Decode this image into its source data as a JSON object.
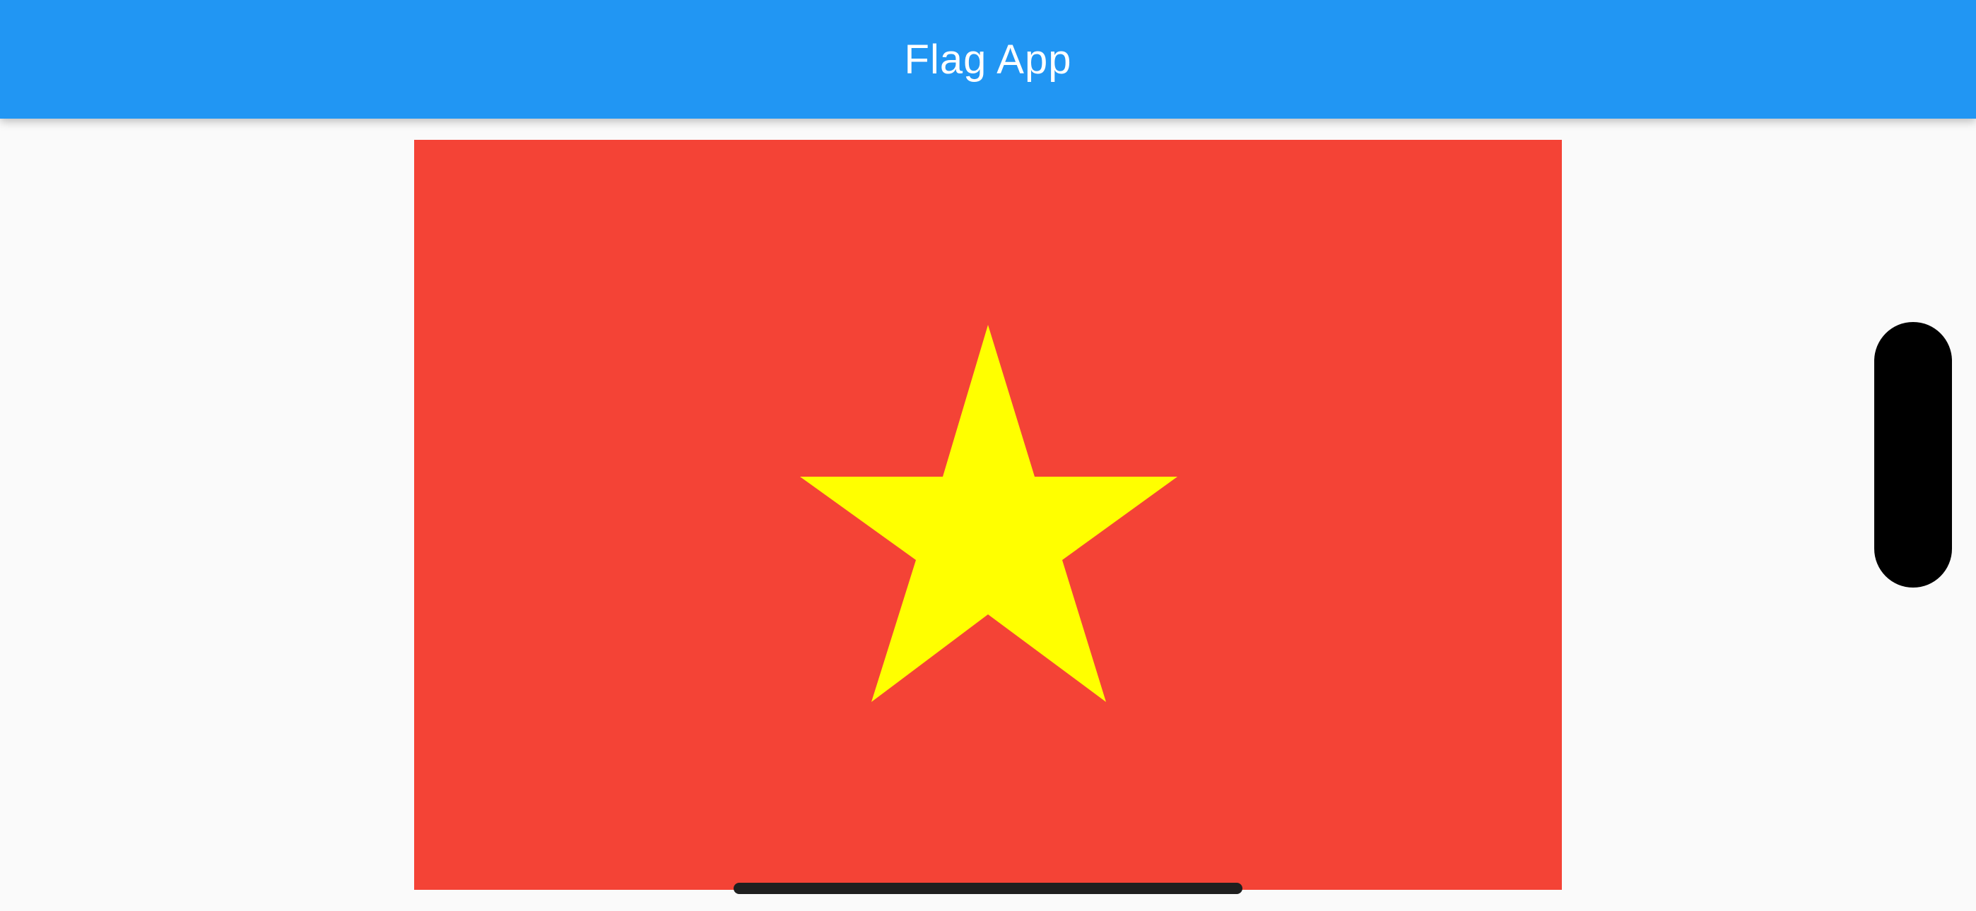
{
  "app_bar": {
    "title": "Flag App",
    "background": "#2196f3",
    "text_color": "#ffffff"
  },
  "flag": {
    "field_color": "#f44336",
    "star_color": "#ffff00",
    "emblem": "five-pointed-star"
  },
  "device": {
    "sensor_housing_color": "#000000",
    "home_indicator_color": "#1f1f1f"
  },
  "page": {
    "background": "#fafafa"
  }
}
